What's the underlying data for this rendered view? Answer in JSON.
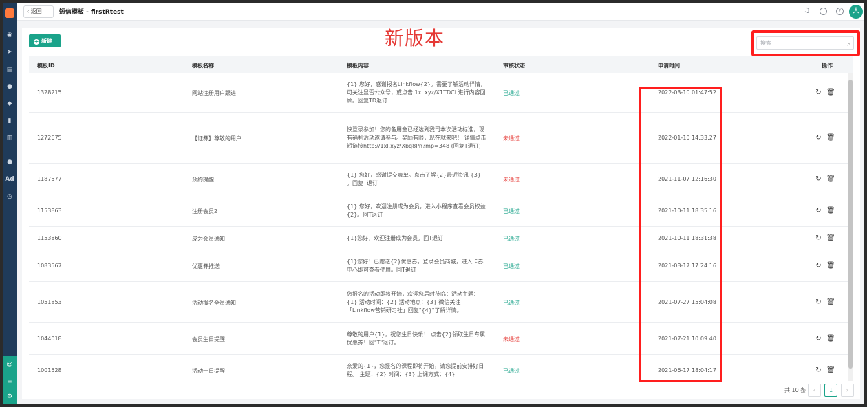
{
  "header": {
    "back_label": "返回",
    "title": "短信模板 - firstRtest",
    "avatar_letter": "人"
  },
  "annotation": "新版本",
  "toolbar": {
    "new_label": "新建"
  },
  "search": {
    "placeholder": "搜索"
  },
  "table": {
    "columns": [
      "模板ID",
      "模板名称",
      "模板内容",
      "审核状态",
      "申请时间",
      "操作"
    ],
    "rows": [
      {
        "id": "1328215",
        "name": "网站注册用户跟进",
        "content": "{1} 您好，感谢报名Linkflow{2}。需要了解活动详情，可关注显否公众号，或点击 1xl.xyz/X1TDCi 进行内容回顾。回复TD退订",
        "status": "已通过",
        "time": "2022-03-10 01:47:52"
      },
      {
        "id": "1272675",
        "name": "【证券】尊敬的用户",
        "content": "快登录参加！您的备用金已经达到我司本次活动标准，现有福利活动邀请参与。奖励有限，现在就来吧！ 详情点击短链接http://1xl.xyz/Xbq8Pn?mp=348 (回复T退订)",
        "status": "未通过",
        "time": "2022-01-10 14:33:27"
      },
      {
        "id": "1187577",
        "name": "预约提醒",
        "content": "{1} 您好，感谢提交表单。点击了解{2}最近资讯 {3} 。回复T退订",
        "status": "未通过",
        "time": "2021-11-07 12:16:30"
      },
      {
        "id": "1153863",
        "name": "注册会员2",
        "content": "{1} 您好，欢迎注册成为会员，进入小程序查看会员权益{2}。回T退订",
        "status": "已通过",
        "time": "2021-10-11 18:35:16"
      },
      {
        "id": "1153860",
        "name": "成为会员通知",
        "content": "{1}您好，欢迎注册成为会员。回T退订",
        "status": "已通过",
        "time": "2021-10-11 18:31:38"
      },
      {
        "id": "1083567",
        "name": "优惠券推送",
        "content": "{1}您好！已赠送{2}优惠券，登录会员商城，进入卡券中心即可查看使用。回T退订",
        "status": "已通过",
        "time": "2021-08-17 17:24:16"
      },
      {
        "id": "1051853",
        "name": "活动报名全员通知",
        "content": "您报名的活动即将开始，欢迎您届时莅临：活动主题：{1} 活动时间：{2} 活动地点：{3} 微信关注「Linkflow营销研习社」回复\"{4}\"了解详情。",
        "status": "已通过",
        "time": "2021-07-27 15:04:08"
      },
      {
        "id": "1044018",
        "name": "会员生日提醒",
        "content": "尊敬的用户{1}，祝您生日快乐！ 点击{2}领取生日专属优惠券！回\"T\"退订。",
        "status": "未通过",
        "time": "2021-07-21 10:09:40"
      },
      {
        "id": "1001528",
        "name": "活动一日提醒",
        "content": "亲爱的{1}，您报名的课程即将开始，请您提前安排好日程。 主题：{2} 时间：{3} 上课方式：{4}",
        "status": "已通过",
        "time": "2021-06-17 18:04:17"
      }
    ]
  },
  "footer": {
    "total": "共 10 条",
    "page": "1"
  },
  "colors": {
    "accent": "#1aa38a",
    "approved": "#1aa38a",
    "rejected": "#e53935",
    "annotation": "#ff1e1e"
  }
}
